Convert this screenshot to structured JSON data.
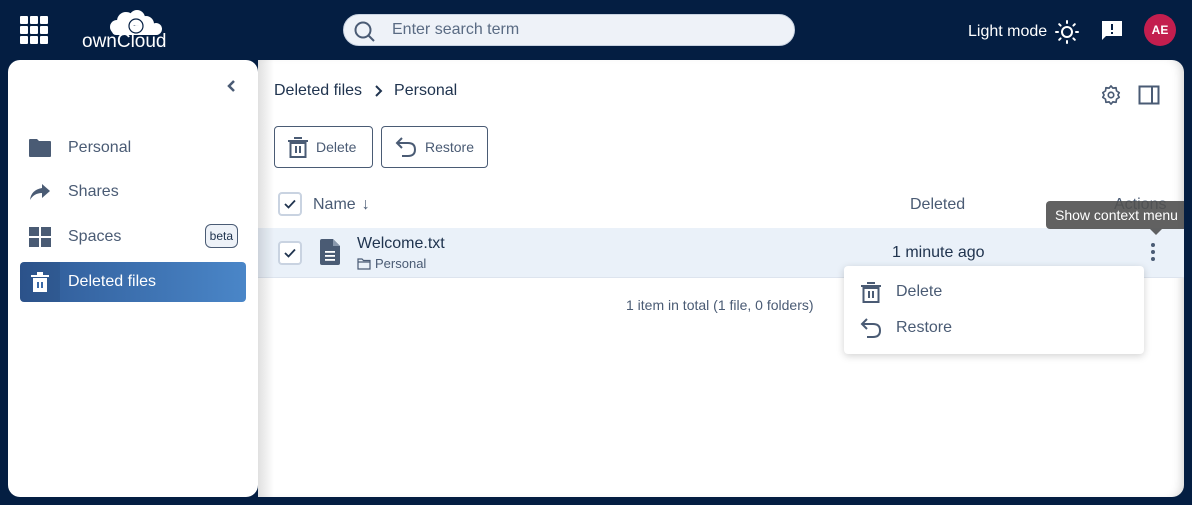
{
  "topbar": {
    "logo_text": "ownCloud",
    "search_placeholder": "Enter search term",
    "theme_toggle_label": "Light mode",
    "avatar_initials": "AE"
  },
  "sidebar": {
    "items": [
      {
        "label": "Personal",
        "icon": "folder-icon",
        "active": false
      },
      {
        "label": "Shares",
        "icon": "share-icon",
        "active": false
      },
      {
        "label": "Spaces",
        "icon": "spaces-grid-icon",
        "active": false,
        "badge": "beta"
      },
      {
        "label": "Deleted files",
        "icon": "trash-icon",
        "active": true
      }
    ]
  },
  "main": {
    "breadcrumb": [
      "Deleted files",
      "Personal"
    ],
    "toolbar": {
      "delete_label": "Delete",
      "restore_label": "Restore"
    },
    "table": {
      "columns": {
        "name": "Name",
        "deleted": "Deleted",
        "actions": "Actions"
      },
      "sort_indicator": "↓",
      "rows": [
        {
          "name": "Welcome.txt",
          "location": "Personal",
          "deleted": "1 minute ago",
          "selected": true
        }
      ],
      "footer": "1 item in total (1 file, 0 folders)"
    },
    "tooltip": "Show context menu",
    "context_menu": [
      {
        "label": "Delete",
        "icon": "trash-icon"
      },
      {
        "label": "Restore",
        "icon": "restore-icon"
      }
    ]
  },
  "colors": {
    "topbar_bg": "#041e42",
    "accent": "#4a86c8",
    "avatar_bg": "#c31e4e",
    "row_selected_bg": "#eaf1f9"
  }
}
